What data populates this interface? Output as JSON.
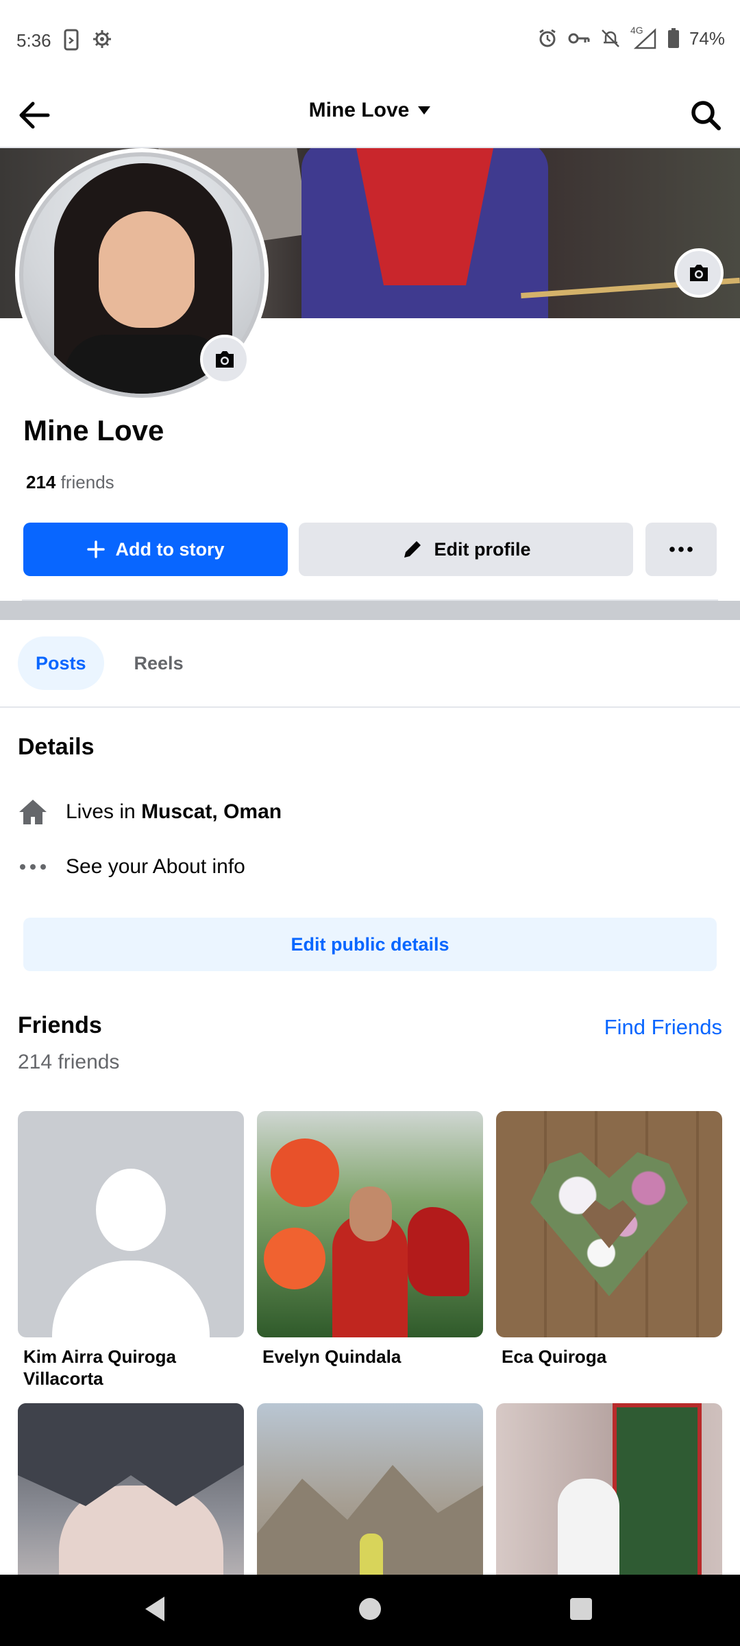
{
  "status_bar": {
    "time": "5:36",
    "network": "4G",
    "battery": "74%"
  },
  "header": {
    "title": "Mine Love"
  },
  "profile": {
    "name": "Mine Love",
    "friends_count": "214",
    "friends_word": "friends"
  },
  "actions": {
    "add_story": "Add to story",
    "edit_profile": "Edit profile"
  },
  "tabs": [
    {
      "label": "Posts",
      "active": true
    },
    {
      "label": "Reels",
      "active": false
    }
  ],
  "details": {
    "title": "Details",
    "lives_prefix": "Lives in",
    "location": "Muscat, Oman",
    "about": "See your About info",
    "edit_button": "Edit public details"
  },
  "friends": {
    "title": "Friends",
    "find_link": "Find Friends",
    "subtitle": "214 friends",
    "list": [
      {
        "name": "Kim Airra Quiroga Villacorta"
      },
      {
        "name": "Evelyn Quindala"
      },
      {
        "name": "Eca Quiroga"
      },
      {
        "name": ""
      },
      {
        "name": ""
      },
      {
        "name": ""
      }
    ]
  },
  "colors": {
    "accent": "#0866ff",
    "accent_light": "#ebf5ff",
    "secondary_button": "#e4e6eb"
  }
}
